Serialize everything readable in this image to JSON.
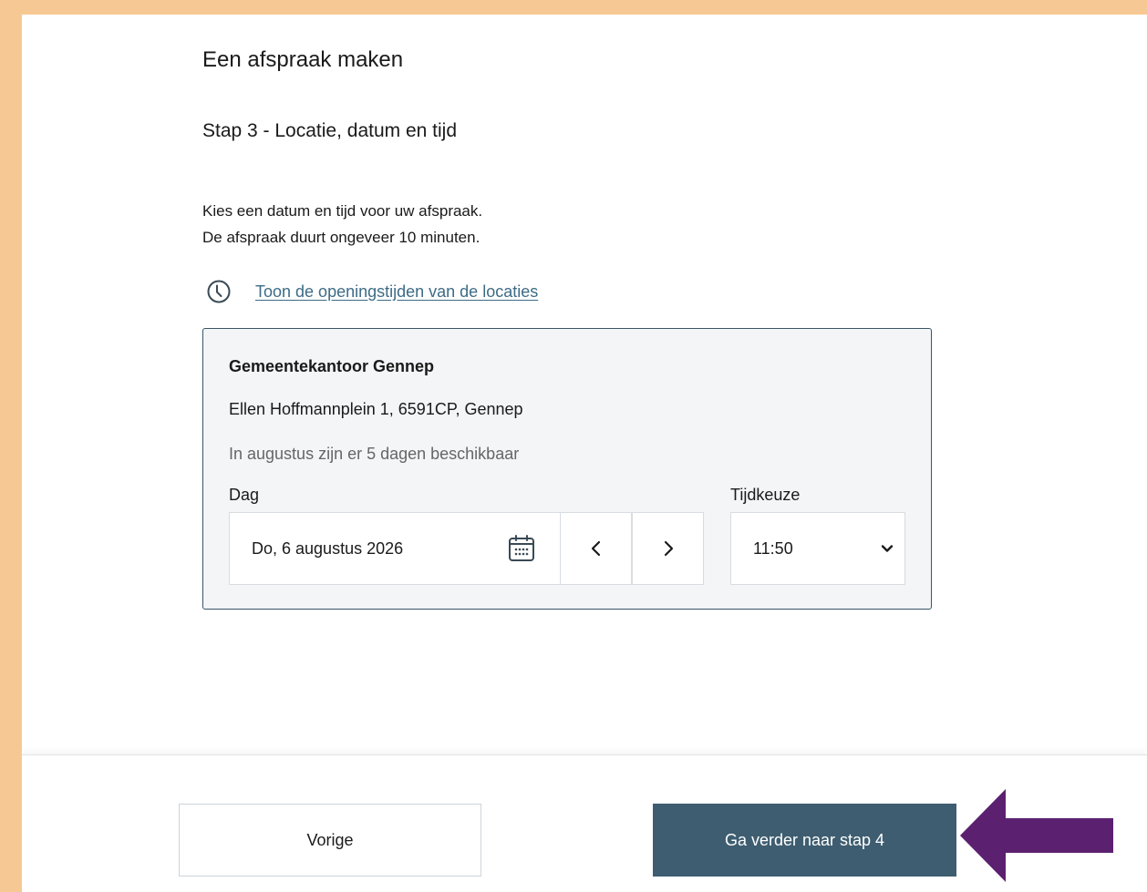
{
  "header": {
    "title": "Een afspraak maken",
    "step_title": "Stap 3 - Locatie, datum en tijd"
  },
  "intro": {
    "line1": "Kies een datum en tijd voor uw afspraak.",
    "line2": "De afspraak duurt ongeveer 10 minuten."
  },
  "opening_hours_link": {
    "icon": "clock-icon",
    "label": "Toon de openingstijden van de locaties"
  },
  "location": {
    "name": "Gemeentekantoor Gennep",
    "address": "Ellen Hoffmannplein 1, 6591CP, Gennep",
    "availability": "In augustus zijn er 5 dagen beschikbaar"
  },
  "date_picker": {
    "label": "Dag",
    "value": "Do, 6 augustus 2026",
    "icon": "calendar-icon",
    "prev_icon": "chevron-left-icon",
    "next_icon": "chevron-right-icon",
    "prev_glyph": "‹",
    "next_glyph": "›"
  },
  "time_picker": {
    "label": "Tijdkeuze",
    "value": "11:50",
    "icon": "chevron-down-icon"
  },
  "footer": {
    "prev_label": "Vorige",
    "next_label": "Ga verder naar stap 4",
    "annotation_icon": "arrow-left-icon"
  },
  "colors": {
    "frame": "#f6c994",
    "primary_button": "#3e5d70",
    "card_border": "#3a5566",
    "link": "#3d6b86",
    "annotation_arrow": "#5c2070"
  }
}
